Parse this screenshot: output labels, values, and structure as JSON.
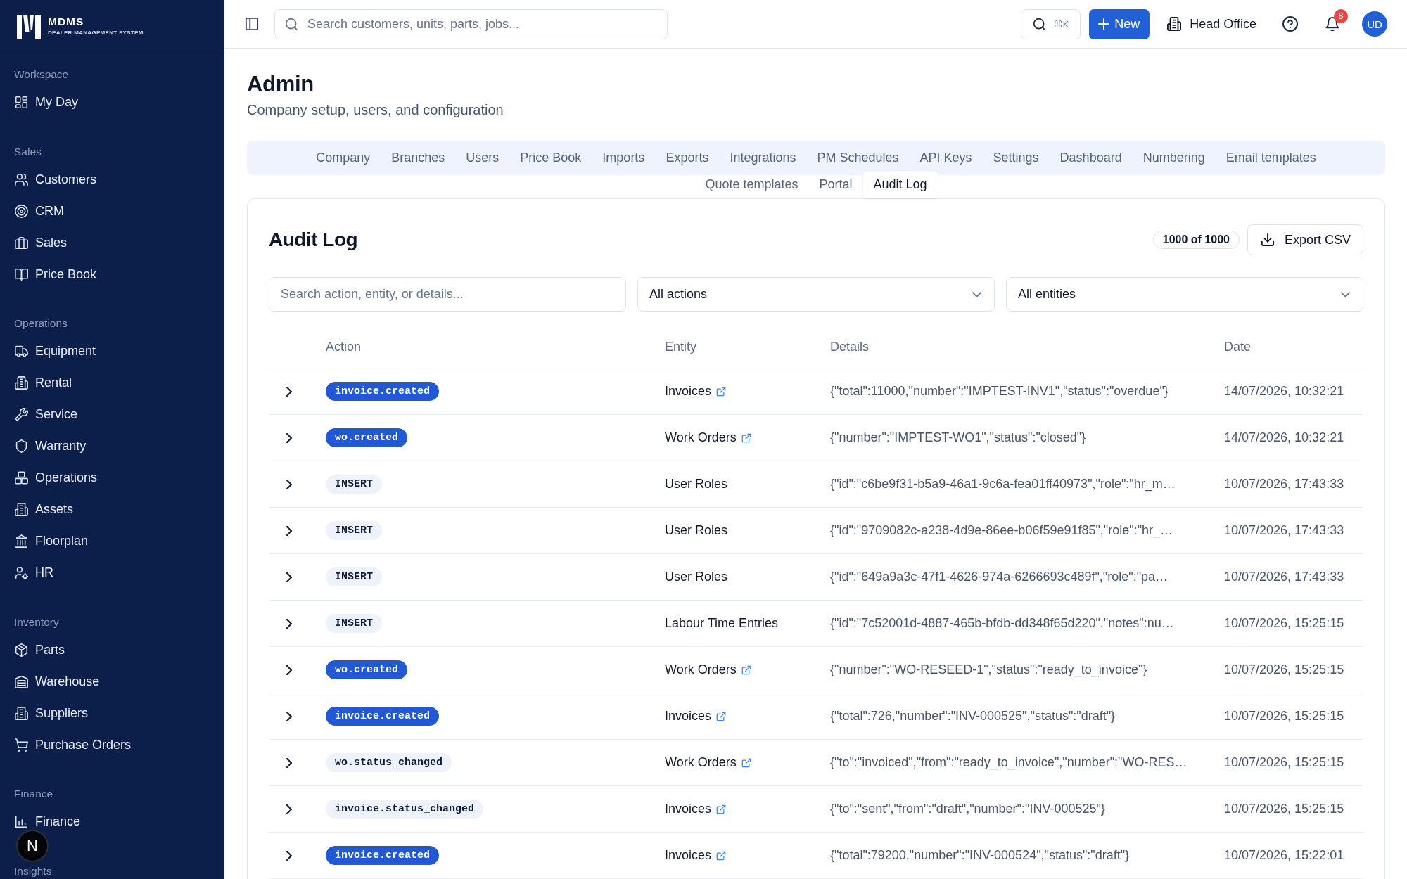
{
  "sidebar": {
    "logo": {
      "name": "MDMS",
      "tagline": "DEALER MANAGEMENT SYSTEM"
    },
    "sections": [
      {
        "label": "Workspace",
        "items": [
          {
            "label": "My Day",
            "selected": false
          }
        ]
      },
      {
        "label": "Sales",
        "items": [
          {
            "label": "Customers",
            "selected": false
          },
          {
            "label": "CRM",
            "selected": false
          },
          {
            "label": "Sales",
            "selected": false
          },
          {
            "label": "Price Book",
            "selected": false
          }
        ]
      },
      {
        "label": "Operations",
        "items": [
          {
            "label": "Equipment",
            "selected": false
          },
          {
            "label": "Rental",
            "selected": false
          },
          {
            "label": "Service",
            "selected": false
          },
          {
            "label": "Warranty",
            "selected": false
          },
          {
            "label": "Operations",
            "selected": false
          },
          {
            "label": "Assets",
            "selected": false
          },
          {
            "label": "Floorplan",
            "selected": false
          },
          {
            "label": "HR",
            "selected": false
          }
        ]
      },
      {
        "label": "Inventory",
        "items": [
          {
            "label": "Parts",
            "selected": false
          },
          {
            "label": "Warehouse",
            "selected": false
          },
          {
            "label": "Suppliers",
            "selected": false
          },
          {
            "label": "Purchase Orders",
            "selected": false
          }
        ]
      },
      {
        "label": "Finance",
        "items": [
          {
            "label": "Finance",
            "selected": false
          }
        ]
      },
      {
        "label": "Insights"
      }
    ]
  },
  "dev_indicator": {
    "label": "N"
  },
  "header": {
    "search": {
      "placeholder": "Search customers, units, parts, jobs..."
    },
    "shortcut": "⌘K",
    "new_button": "New",
    "branch": "Head Office",
    "notifications": {
      "count": "8"
    },
    "avatar": "UD"
  },
  "page": {
    "title": "Admin",
    "subtitle": "Company setup, users, and configuration"
  },
  "tab_rows": [
    {
      "tabs": [
        {
          "label": "Company",
          "selected": false
        },
        {
          "label": "Branches",
          "selected": false
        },
        {
          "label": "Users",
          "selected": false
        },
        {
          "label": "Price Book",
          "selected": false
        },
        {
          "label": "Imports",
          "selected": false
        },
        {
          "label": "Exports",
          "selected": false
        },
        {
          "label": "Integrations",
          "selected": false
        },
        {
          "label": "PM Schedules",
          "selected": false
        },
        {
          "label": "API Keys",
          "selected": false
        },
        {
          "label": "Settings",
          "selected": false
        },
        {
          "label": "Dashboard",
          "selected": false
        },
        {
          "label": "Numbering",
          "selected": false
        },
        {
          "label": "Email templates",
          "selected": false
        }
      ]
    },
    {
      "tabs": [
        {
          "label": "Quote templates",
          "selected": false
        },
        {
          "label": "Portal",
          "selected": false
        },
        {
          "label": "Audit Log",
          "selected": true
        }
      ]
    }
  ],
  "audit_log": {
    "title": "Audit Log",
    "count": "1000 of 1000",
    "export_button": "Export CSV",
    "filters": {
      "search": {
        "placeholder": "Search action, entity, or details..."
      },
      "action_select": "All actions",
      "entity_select": "All entities"
    },
    "table": {
      "columns": [
        "Action",
        "Entity",
        "Details",
        "Date"
      ],
      "rows": [
        {
          "expanded": false,
          "action": {
            "text": "invoice.created",
            "kind": "filled"
          },
          "entity": {
            "text": "Invoices",
            "linked": true
          },
          "details": "{\"total\":11000,\"number\":\"IMPTEST-INV1\",\"status\":\"overdue\"}",
          "date": "14/07/2026, 10:32:21"
        },
        {
          "expanded": false,
          "action": {
            "text": "wo.created",
            "kind": "filled"
          },
          "entity": {
            "text": "Work Orders",
            "linked": true
          },
          "details": "{\"number\":\"IMPTEST-WO1\",\"status\":\"closed\"}",
          "date": "14/07/2026, 10:32:21"
        },
        {
          "expanded": false,
          "action": {
            "text": "INSERT",
            "kind": "soft"
          },
          "entity": {
            "text": "User Roles",
            "linked": false
          },
          "details": "{\"id\":\"c6be9f31-b5a9-46a1-9c6a-fea01ff40973\",\"role\":\"hr_m…",
          "date": "10/07/2026, 17:43:33"
        },
        {
          "expanded": false,
          "action": {
            "text": "INSERT",
            "kind": "soft"
          },
          "entity": {
            "text": "User Roles",
            "linked": false
          },
          "details": "{\"id\":\"9709082c-a238-4d9e-86ee-b06f59e91f85\",\"role\":\"hr_…",
          "date": "10/07/2026, 17:43:33"
        },
        {
          "expanded": false,
          "action": {
            "text": "INSERT",
            "kind": "soft"
          },
          "entity": {
            "text": "User Roles",
            "linked": false
          },
          "details": "{\"id\":\"649a9a3c-47f1-4626-974a-6266693c489f\",\"role\":\"pa…",
          "date": "10/07/2026, 17:43:33"
        },
        {
          "expanded": false,
          "action": {
            "text": "INSERT",
            "kind": "soft"
          },
          "entity": {
            "text": "Labour Time Entries",
            "linked": false
          },
          "details": "{\"id\":\"7c52001d-4887-465b-bfdb-dd348f65d220\",\"notes\":nu…",
          "date": "10/07/2026, 15:25:15"
        },
        {
          "expanded": false,
          "action": {
            "text": "wo.created",
            "kind": "filled"
          },
          "entity": {
            "text": "Work Orders",
            "linked": true
          },
          "details": "{\"number\":\"WO-RESEED-1\",\"status\":\"ready_to_invoice\"}",
          "date": "10/07/2026, 15:25:15"
        },
        {
          "expanded": false,
          "action": {
            "text": "invoice.created",
            "kind": "filled"
          },
          "entity": {
            "text": "Invoices",
            "linked": true
          },
          "details": "{\"total\":726,\"number\":\"INV-000525\",\"status\":\"draft\"}",
          "date": "10/07/2026, 15:25:15"
        },
        {
          "expanded": false,
          "action": {
            "text": "wo.status_changed",
            "kind": "soft"
          },
          "entity": {
            "text": "Work Orders",
            "linked": true
          },
          "details": "{\"to\":\"invoiced\",\"from\":\"ready_to_invoice\",\"number\":\"WO-RES…",
          "date": "10/07/2026, 15:25:15"
        },
        {
          "expanded": false,
          "action": {
            "text": "invoice.status_changed",
            "kind": "soft"
          },
          "entity": {
            "text": "Invoices",
            "linked": true
          },
          "details": "{\"to\":\"sent\",\"from\":\"draft\",\"number\":\"INV-000525\"}",
          "date": "10/07/2026, 15:25:15"
        },
        {
          "expanded": false,
          "action": {
            "text": "invoice.created",
            "kind": "filled"
          },
          "entity": {
            "text": "Invoices",
            "linked": true
          },
          "details": "{\"total\":79200,\"number\":\"INV-000524\",\"status\":\"draft\"}",
          "date": "10/07/2026, 15:22:01"
        }
      ]
    }
  }
}
